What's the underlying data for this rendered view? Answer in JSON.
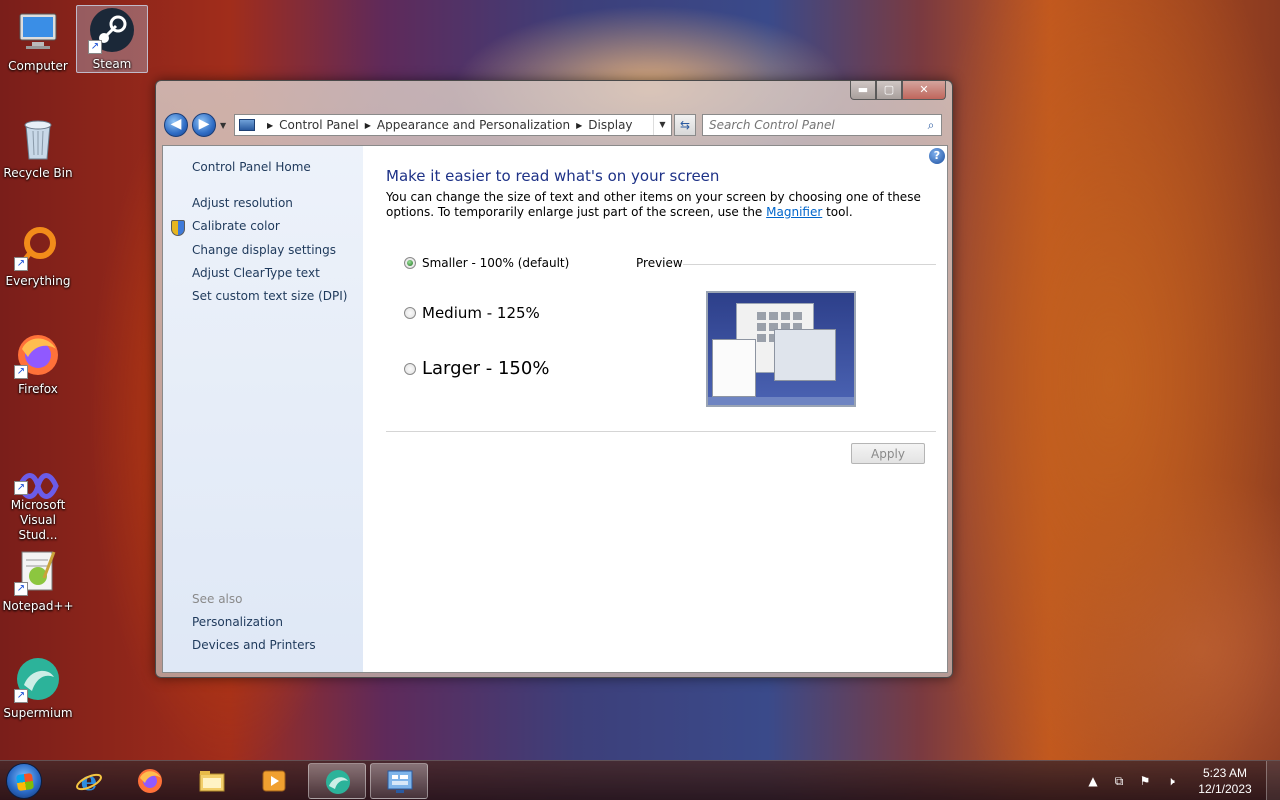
{
  "desktop": {
    "icons": [
      {
        "label": "Computer"
      },
      {
        "label": "Steam"
      },
      {
        "label": "Recycle Bin"
      },
      {
        "label": "Everything"
      },
      {
        "label": "Firefox"
      },
      {
        "label": "Microsoft\nVisual Stud..."
      },
      {
        "label": "Notepad++"
      },
      {
        "label": "Supermium"
      }
    ]
  },
  "window": {
    "caption": {
      "minimize": "▬",
      "maximize": "▢",
      "close": "✕"
    },
    "address": {
      "crumbs": [
        "Control Panel",
        "Appearance and Personalization",
        "Display"
      ]
    },
    "search": {
      "placeholder": "Search Control Panel"
    },
    "sidebar": {
      "links": [
        "Control Panel Home",
        "Adjust resolution",
        "Calibrate color",
        "Change display settings",
        "Adjust ClearType text",
        "Set custom text size (DPI)"
      ],
      "see_also_heading": "See also",
      "see_also": [
        "Personalization",
        "Devices and Printers"
      ]
    },
    "main": {
      "title": "Make it easier to read what's on your screen",
      "desc_part1": "You can change the size of text and other items on your screen by choosing one of these options. To temporarily enlarge just part of the screen, use the ",
      "desc_link": "Magnifier",
      "desc_part2": " tool.",
      "options": [
        {
          "label": "Smaller - 100% (default)",
          "checked": true
        },
        {
          "label": "Medium - 125%",
          "checked": false
        },
        {
          "label": "Larger - 150%",
          "checked": false
        }
      ],
      "preview_label": "Preview",
      "apply_label": "Apply"
    }
  },
  "taskbar": {
    "clock_time": "5:23 AM",
    "clock_date": "12/1/2023"
  }
}
